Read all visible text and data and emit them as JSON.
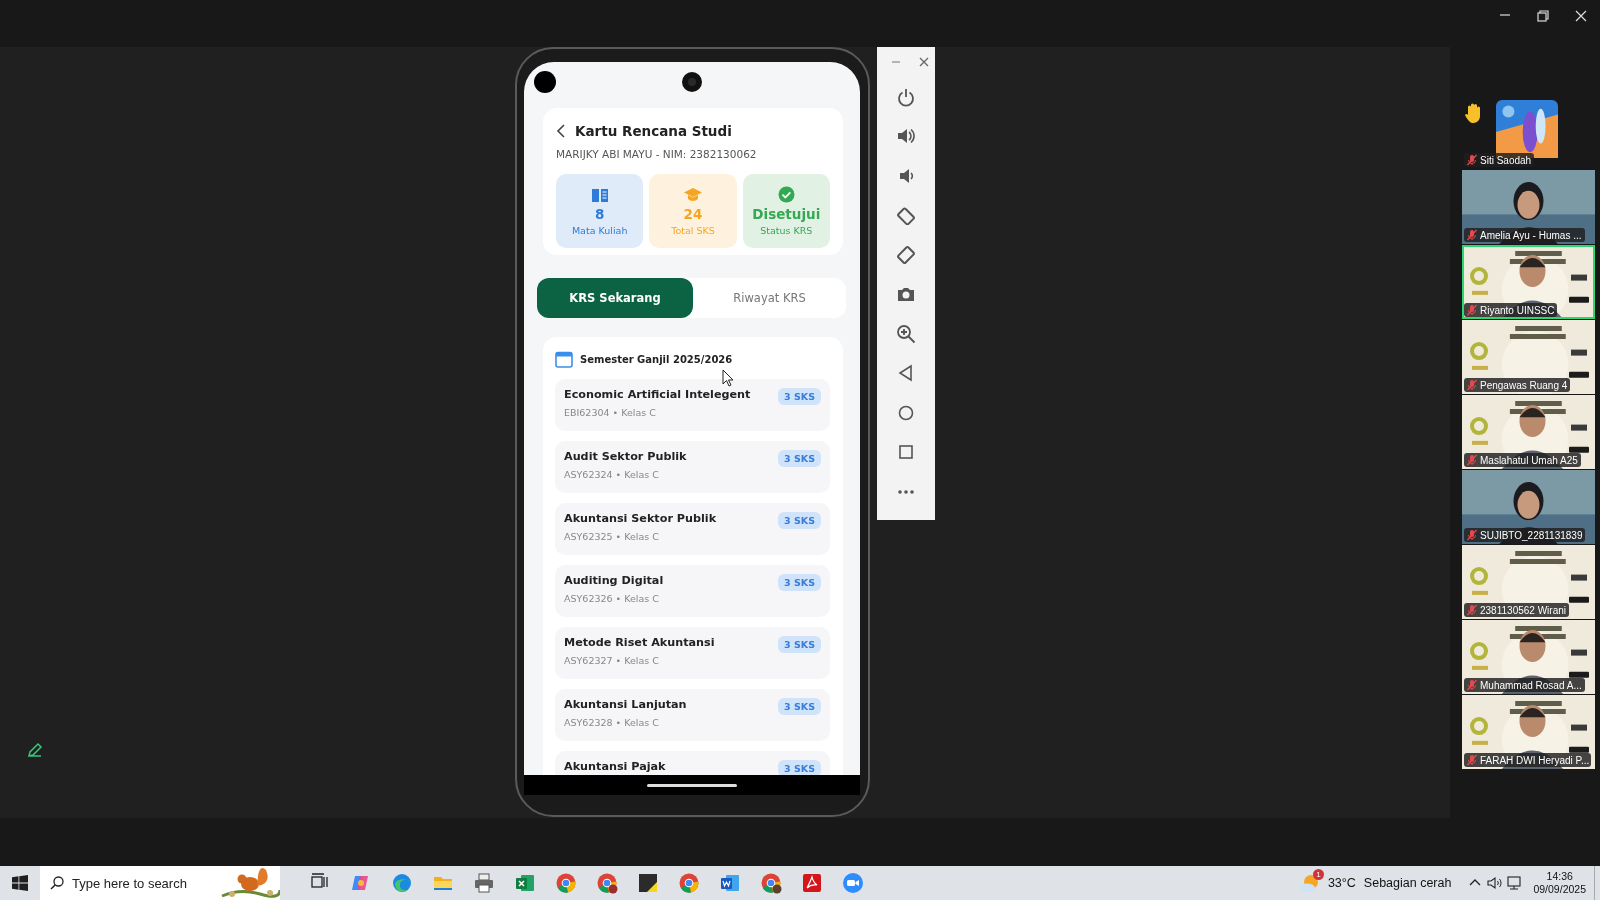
{
  "emulator_app": {
    "title": "Kartu Rencana Studi",
    "student": "MARIJKY ABI MAYU - NIM: 2382130062",
    "stats": [
      {
        "kind": "courses",
        "value": "8",
        "label": "Mata Kuliah",
        "color": "#2f7bd9"
      },
      {
        "kind": "credits",
        "value": "24",
        "label": "Total SKS",
        "color": "#f5a524"
      },
      {
        "kind": "status",
        "value": "Disetujui",
        "label": "Status KRS",
        "color": "#34a853"
      }
    ],
    "tabs": [
      {
        "label": "KRS Sekarang",
        "selected": true
      },
      {
        "label": "Riwayat KRS",
        "selected": false
      }
    ],
    "semester": "Semester Ganjil 2025/2026",
    "courses": [
      {
        "name": "Economic Artificial Intelegent",
        "code": "EBI62304 • Kelas C",
        "credits": "3 SKS"
      },
      {
        "name": "Audit Sektor Publik",
        "code": "ASY62324 • Kelas C",
        "credits": "3 SKS"
      },
      {
        "name": "Akuntansi Sektor Publik",
        "code": "ASY62325 • Kelas C",
        "credits": "3 SKS"
      },
      {
        "name": "Auditing Digital",
        "code": "ASY62326 • Kelas C",
        "credits": "3 SKS"
      },
      {
        "name": "Metode Riset Akuntansi",
        "code": "ASY62327 • Kelas C",
        "credits": "3 SKS"
      },
      {
        "name": "Akuntansi Lanjutan",
        "code": "ASY62328 • Kelas C",
        "credits": "3 SKS"
      },
      {
        "name": "Akuntansi Pajak",
        "credits": "3 SKS"
      }
    ]
  },
  "participants": [
    {
      "name": "Siti Saodah",
      "kind": "avatar",
      "hand_raised": true,
      "muted": true,
      "active_speaker": false
    },
    {
      "name": "Amelia Ayu - Humas ...",
      "kind": "video",
      "hand_raised": false,
      "muted": true,
      "active_speaker": false
    },
    {
      "name": "Riyanto UINSSC",
      "kind": "video",
      "hand_raised": false,
      "muted": true,
      "active_speaker": true
    },
    {
      "name": "Pengawas Ruang 4",
      "kind": "video",
      "hand_raised": false,
      "muted": true,
      "active_speaker": false
    },
    {
      "name": "Maslahatul Umah A25",
      "kind": "video",
      "hand_raised": false,
      "muted": true,
      "active_speaker": false
    },
    {
      "name": "SUJIBTO_2281131839",
      "kind": "video",
      "hand_raised": false,
      "muted": true,
      "active_speaker": false
    },
    {
      "name": "2381130562 Wirani",
      "kind": "video",
      "hand_raised": false,
      "muted": true,
      "active_speaker": false
    },
    {
      "name": "Muhammad Rosad A...",
      "kind": "video",
      "hand_raised": false,
      "muted": true,
      "active_speaker": false
    },
    {
      "name": "FARAH DWI Heryadi P...",
      "kind": "video",
      "hand_raised": false,
      "muted": true,
      "active_speaker": false
    }
  ],
  "taskbar": {
    "search_placeholder": "Type here to search",
    "weather": {
      "badge": "1",
      "temperature": "33°C",
      "condition": "Sebagian cerah"
    },
    "time": "14:36",
    "date": "09/09/2025"
  }
}
